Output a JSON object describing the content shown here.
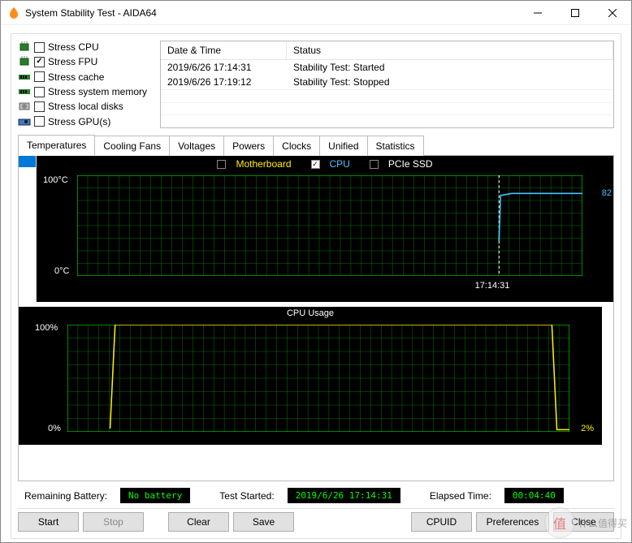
{
  "window": {
    "title": "System Stability Test - AIDA64"
  },
  "stress": {
    "items": [
      {
        "label": "Stress CPU",
        "checked": false,
        "icon": "cpu"
      },
      {
        "label": "Stress FPU",
        "checked": true,
        "icon": "cpu"
      },
      {
        "label": "Stress cache",
        "checked": false,
        "icon": "ram"
      },
      {
        "label": "Stress system memory",
        "checked": false,
        "icon": "ram"
      },
      {
        "label": "Stress local disks",
        "checked": false,
        "icon": "disk"
      },
      {
        "label": "Stress GPU(s)",
        "checked": false,
        "icon": "gpu"
      }
    ]
  },
  "log": {
    "headers": [
      "Date & Time",
      "Status"
    ],
    "rows": [
      {
        "dt": "2019/6/26 17:14:31",
        "status": "Stability Test: Started"
      },
      {
        "dt": "2019/6/26 17:19:12",
        "status": "Stability Test: Stopped"
      }
    ]
  },
  "tabs": [
    "Temperatures",
    "Cooling Fans",
    "Voltages",
    "Powers",
    "Clocks",
    "Unified",
    "Statistics"
  ],
  "active_tab": 0,
  "temp_chart": {
    "legend": [
      {
        "label": "Motherboard",
        "checked": false,
        "color": "#ffee00"
      },
      {
        "label": "CPU",
        "checked": true,
        "color": "#49c2ff"
      },
      {
        "label": "PCIe SSD",
        "checked": false,
        "color": "#ffffff"
      }
    ],
    "y_max_label": "100°C",
    "y_min_label": "0°C",
    "current_value": "82",
    "time_marker": "17:14:31"
  },
  "cpu_chart": {
    "title": "CPU Usage",
    "y_max_label": "100%",
    "y_min_label": "0%",
    "current_value": "2%"
  },
  "status": {
    "battery_label": "Remaining Battery:",
    "battery_value": "No battery",
    "started_label": "Test Started:",
    "started_value": "2019/6/26 17:14:31",
    "elapsed_label": "Elapsed Time:",
    "elapsed_value": "00:04:40"
  },
  "buttons": {
    "start": "Start",
    "stop": "Stop",
    "clear": "Clear",
    "save": "Save",
    "cpuid": "CPUID",
    "prefs": "Preferences",
    "close": "Close"
  },
  "watermark": "什么值得买",
  "chart_data": {
    "temperatures": {
      "type": "line",
      "xlabel": "time",
      "ylabel": "°C",
      "ylim": [
        0,
        100
      ],
      "series": [
        {
          "name": "CPU",
          "color": "#49c2ff",
          "points": [
            {
              "x_frac": 0.835,
              "y": 35
            },
            {
              "x_frac": 0.838,
              "y": 80
            },
            {
              "x_frac": 0.86,
              "y": 82
            },
            {
              "x_frac": 1.0,
              "y": 82
            }
          ]
        }
      ],
      "vertical_marker": {
        "x_frac": 0.835,
        "label": "17:14:31"
      }
    },
    "cpu_usage": {
      "type": "line",
      "xlabel": "time",
      "ylabel": "%",
      "ylim": [
        0,
        100
      ],
      "series": [
        {
          "name": "CPU Usage",
          "color": "#ffee00",
          "points": [
            {
              "x_frac": 0.0,
              "y": null
            },
            {
              "x_frac": 0.085,
              "y": 3
            },
            {
              "x_frac": 0.095,
              "y": 100
            },
            {
              "x_frac": 0.965,
              "y": 100
            },
            {
              "x_frac": 0.975,
              "y": 2
            },
            {
              "x_frac": 1.0,
              "y": 2
            }
          ]
        }
      ]
    }
  }
}
